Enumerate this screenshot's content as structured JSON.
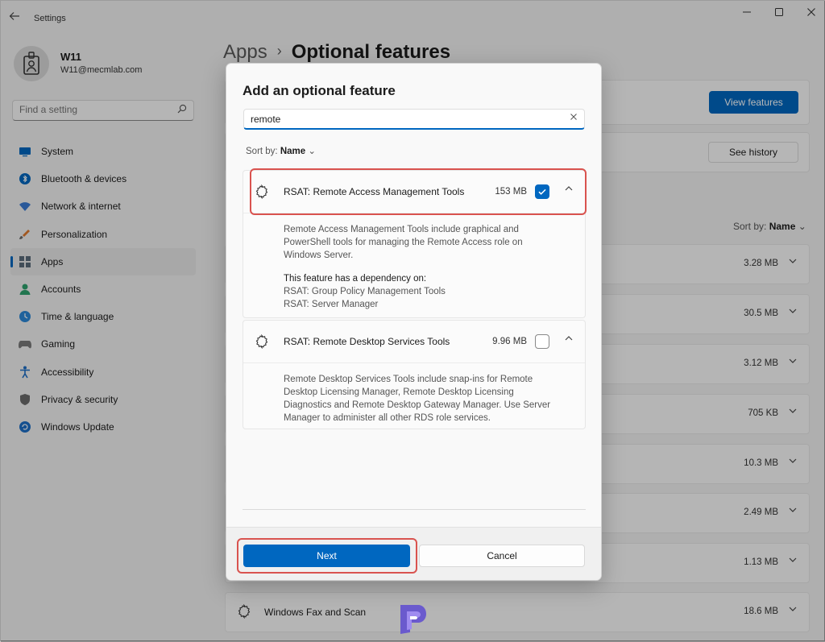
{
  "window": {
    "title": "Settings"
  },
  "profile": {
    "name": "W11",
    "email": "W11@mecmlab.com"
  },
  "search": {
    "placeholder": "Find a setting"
  },
  "nav": [
    {
      "label": "System",
      "icon": "monitor-icon",
      "color": "#0067c0"
    },
    {
      "label": "Bluetooth & devices",
      "icon": "bluetooth-icon",
      "color": "#0067c0"
    },
    {
      "label": "Network & internet",
      "icon": "wifi-icon",
      "color": "#3a7bd5"
    },
    {
      "label": "Personalization",
      "icon": "brush-icon",
      "color": "#e07a2e"
    },
    {
      "label": "Apps",
      "icon": "apps-icon",
      "color": "#5b6b7b",
      "active": true
    },
    {
      "label": "Accounts",
      "icon": "person-icon",
      "color": "#2ea36e"
    },
    {
      "label": "Time & language",
      "icon": "globe-clock-icon",
      "color": "#2b88d8"
    },
    {
      "label": "Gaming",
      "icon": "gamepad-icon",
      "color": "#7a7a7a"
    },
    {
      "label": "Accessibility",
      "icon": "accessibility-icon",
      "color": "#1e6fc6"
    },
    {
      "label": "Privacy & security",
      "icon": "shield-icon",
      "color": "#6b6b6b"
    },
    {
      "label": "Windows Update",
      "icon": "update-icon",
      "color": "#1e6fc6"
    }
  ],
  "breadcrumb": {
    "parent": "Apps",
    "current": "Optional features"
  },
  "background": {
    "view_features": "View features",
    "see_history": "See history",
    "sort_label": "Sort by:",
    "sort_value": "Name",
    "rows": [
      {
        "size": "3.28 MB"
      },
      {
        "size": "30.5 MB"
      },
      {
        "size": "3.12 MB"
      },
      {
        "size": "705 KB"
      },
      {
        "size": "10.3 MB"
      },
      {
        "size": "2.49 MB"
      },
      {
        "size": "1.13 MB"
      },
      {
        "name": "Windows Fax and Scan",
        "size": "18.6 MB"
      }
    ]
  },
  "dialog": {
    "title": "Add an optional feature",
    "search_value": "remote",
    "sort_label": "Sort by:",
    "sort_value": "Name",
    "features": [
      {
        "name": "RSAT: Remote Access Management Tools",
        "size": "153 MB",
        "checked": true,
        "description": [
          "Remote Access Management Tools include graphical and",
          "PowerShell tools for managing the Remote Access role on",
          "Windows Server."
        ],
        "dependency_title": "This feature has a dependency on:",
        "dependencies": [
          "RSAT: Group Policy Management Tools",
          "RSAT: Server Manager"
        ]
      },
      {
        "name": "RSAT: Remote Desktop Services Tools",
        "size": "9.96 MB",
        "checked": false,
        "description": [
          "Remote Desktop Services Tools include snap-ins for Remote",
          "Desktop Licensing Manager, Remote Desktop Licensing",
          "Diagnostics and Remote Desktop Gateway Manager. Use Server",
          "Manager to administer all other RDS role services."
        ]
      }
    ],
    "next_label": "Next",
    "cancel_label": "Cancel"
  },
  "colors": {
    "accent": "#0067c0",
    "highlight": "#d9534f"
  }
}
